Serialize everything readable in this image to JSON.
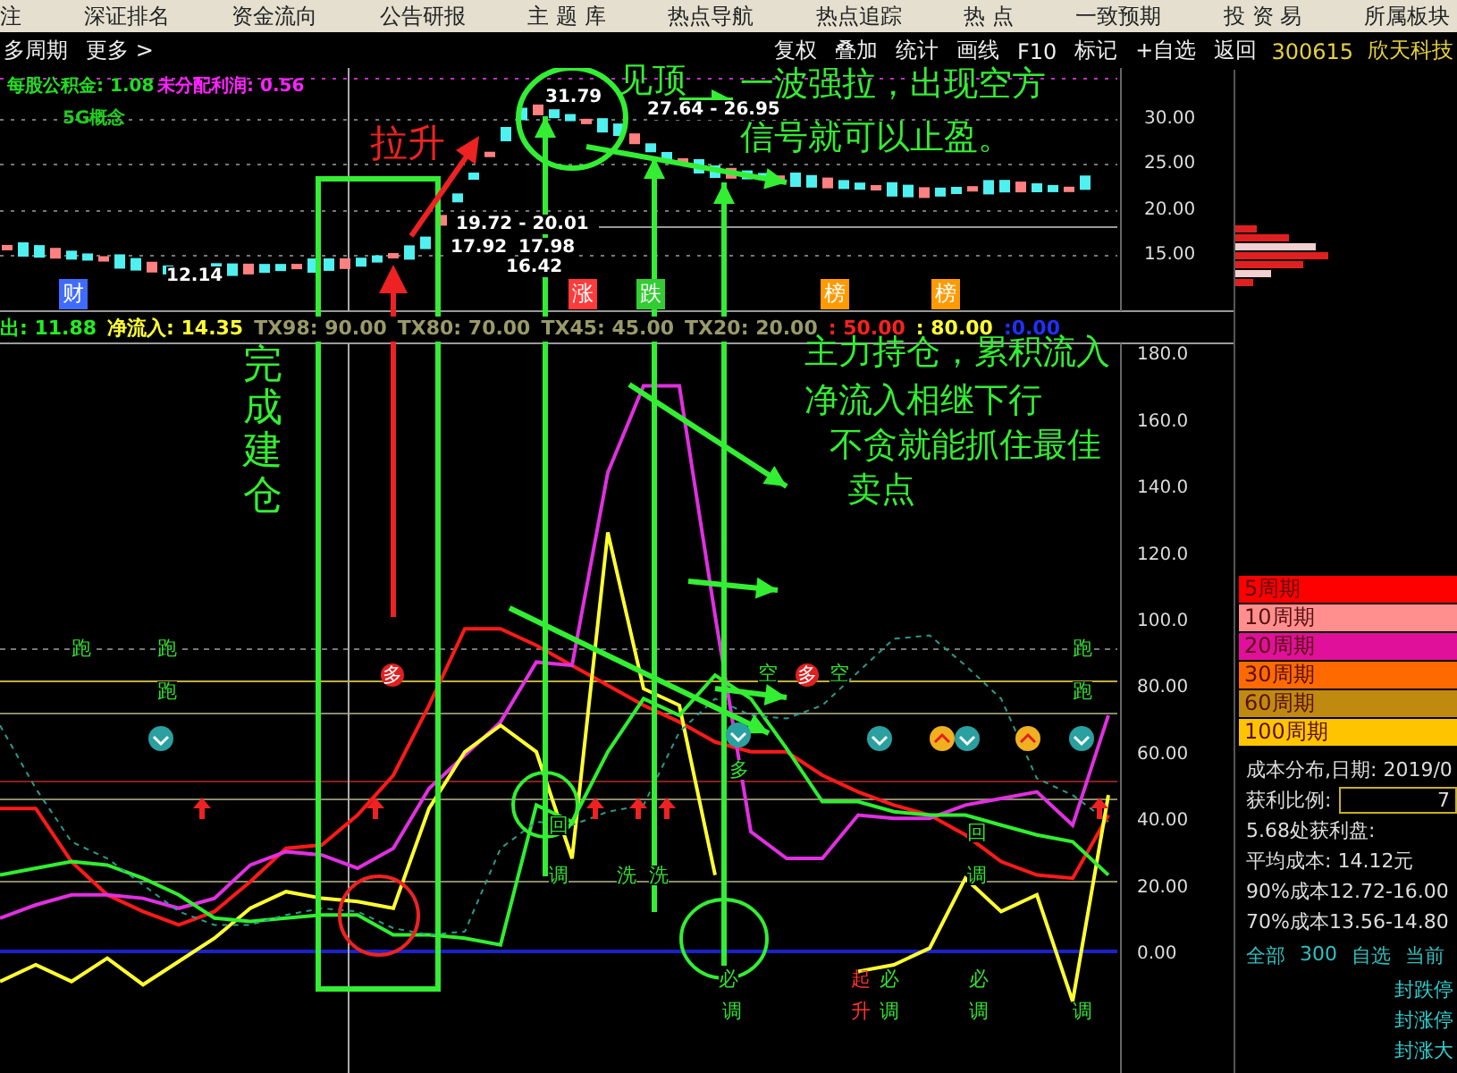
{
  "menu_bar": {
    "items": [
      "注",
      "深证排名",
      "资金流向",
      "公告研报",
      "主 题 库",
      "热点导航",
      "热点追踪",
      "热 点",
      "一致预期",
      "投 资 易",
      "所属板块"
    ]
  },
  "toolbar": {
    "left": [
      "多周期",
      "更多 >"
    ],
    "right": [
      "复权",
      "叠加",
      "统计",
      "画线",
      "F10",
      "标记",
      "+自选",
      "返回"
    ],
    "stock_code": "300615",
    "stock_name": "欣天科技"
  },
  "price_pane": {
    "info": [
      {
        "text": "每股公积金: 1.08",
        "color": "#22dd22"
      },
      {
        "text": "未分配利润: 0.56",
        "color": "#ff22ff"
      }
    ],
    "concept_tag": "5G概念",
    "price_labels": [
      "31.79",
      "27.64 - 26.95",
      "19.72 - 20.01",
      "17.92",
      "17.98",
      "16.42",
      "12.14"
    ],
    "event_tags": [
      {
        "text": "财",
        "color": "#3f6bff"
      },
      {
        "text": "涨",
        "color": "#ff3b3b"
      },
      {
        "text": "跌",
        "color": "#33cc33"
      },
      {
        "text": "榜",
        "color": "#ff9a00"
      },
      {
        "text": "榜",
        "color": "#ff9a00"
      }
    ],
    "axis_labels": [
      "30.00",
      "25.00",
      "20.00",
      "15.00"
    ]
  },
  "indicator_line": [
    {
      "text": "出: 11.88",
      "color": "#22ee22"
    },
    {
      "text": "净流入: 14.35",
      "color": "#ffff33"
    },
    {
      "text": "TX98: 90.00",
      "color": "#9a9a6a"
    },
    {
      "text": "TX80: 70.00",
      "color": "#9a9a6a"
    },
    {
      "text": "TX45: 45.00",
      "color": "#9a9a6a"
    },
    {
      "text": "TX20: 20.00",
      "color": "#9a9a6a"
    },
    {
      "text": ": 50.00",
      "color": "#ff2020"
    },
    {
      "text": ": 80.00",
      "color": "#ffff33"
    },
    {
      "text": ":0.00",
      "color": "#2030ff"
    }
  ],
  "indicator_pane": {
    "chart_data": {
      "type": "line",
      "ylim": [
        -36,
        182
      ],
      "yticks": [
        {
          "value": 180,
          "label": "180.0"
        },
        {
          "value": 160,
          "label": "160.0"
        },
        {
          "value": 140,
          "label": "140.0"
        },
        {
          "value": 120,
          "label": "120.0"
        },
        {
          "value": 100,
          "label": "100.0"
        },
        {
          "value": 80,
          "label": "80.00"
        },
        {
          "value": 60,
          "label": "60.00"
        },
        {
          "value": 40,
          "label": "40.00"
        },
        {
          "value": 20,
          "label": "20.00"
        },
        {
          "value": 0,
          "label": "0.00"
        }
      ],
      "series": [
        {
          "color": "#ff1a1a",
          "line_style": "solid",
          "values": [
            43,
            43,
            27,
            17,
            12,
            8,
            12,
            21,
            31,
            32,
            41,
            53,
            74,
            97,
            97,
            92,
            86,
            80,
            74,
            69,
            63,
            60,
            60,
            53,
            48,
            44,
            41,
            35,
            27,
            23,
            22,
            41
          ]
        },
        {
          "color": "#e030e0",
          "line_style": "solid",
          "values": [
            10,
            14,
            17,
            17,
            16,
            13,
            16,
            26,
            30,
            29,
            25,
            31,
            49,
            59,
            69,
            87,
            86,
            144,
            170,
            170,
            101,
            36,
            28,
            28,
            41,
            40,
            40,
            44,
            46,
            48,
            38,
            71
          ]
        },
        {
          "color": "#ffff30",
          "line_style": "solid",
          "values": [
            -9,
            -4,
            -9,
            -2,
            -10,
            -3,
            4,
            13,
            18,
            16,
            15,
            13,
            43,
            60,
            68,
            60,
            28,
            126,
            79,
            74,
            23,
            null,
            null,
            null,
            -6,
            -4,
            1,
            22,
            12,
            17,
            -15,
            47
          ]
        },
        {
          "color": "#30ee30",
          "line_style": "solid",
          "values": [
            23,
            25,
            27,
            26,
            22,
            17,
            10,
            9,
            10,
            11,
            11,
            5,
            5,
            4,
            2,
            44,
            39,
            60,
            76,
            71,
            83,
            76,
            61,
            45,
            45,
            42,
            41,
            41,
            38,
            35,
            33,
            23
          ]
        },
        {
          "color": "#2a9a8a",
          "line_style": "dashed",
          "values": [
            68,
            49,
            33,
            28,
            20,
            12,
            8,
            8,
            11,
            13,
            12,
            7,
            5,
            6,
            31,
            39,
            38,
            42,
            44,
            66,
            76,
            71,
            70,
            74,
            84,
            94,
            95,
            86,
            76,
            52,
            47,
            39
          ]
        }
      ]
    },
    "signal_marks": [
      {
        "text": "跑",
        "kind": "green"
      },
      {
        "text": "跑",
        "kind": "green"
      },
      {
        "text": "跑",
        "kind": "green"
      },
      {
        "text": "多",
        "kind": "badge"
      },
      {
        "text": "空",
        "kind": "green"
      },
      {
        "text": "多",
        "kind": "badge"
      },
      {
        "text": "空",
        "kind": "green"
      },
      {
        "text": "跑",
        "kind": "green"
      },
      {
        "text": "跑",
        "kind": "green"
      },
      {
        "text": "多",
        "kind": "green"
      },
      {
        "text": "回",
        "kind": "green"
      },
      {
        "text": "回",
        "kind": "green"
      },
      {
        "text": "调",
        "kind": "green"
      },
      {
        "text": "洗",
        "kind": "green"
      },
      {
        "text": "洗",
        "kind": "green"
      },
      {
        "text": "调",
        "kind": "green"
      },
      {
        "text": "必",
        "kind": "green"
      },
      {
        "text": "起",
        "kind": "red"
      },
      {
        "text": "必",
        "kind": "green"
      },
      {
        "text": "必",
        "kind": "green"
      },
      {
        "text": "调",
        "kind": "green"
      },
      {
        "text": "升",
        "kind": "red"
      },
      {
        "text": "调",
        "kind": "green"
      },
      {
        "text": "调",
        "kind": "green"
      },
      {
        "text": "调",
        "kind": "green"
      }
    ]
  },
  "annotations": [
    {
      "text": "完成建仓",
      "kind": "vertical"
    },
    {
      "text": "拉升",
      "kind": "red"
    },
    {
      "text": "见顶",
      "kind": "green"
    },
    {
      "text": "一波强拉，出现空方",
      "kind": "green"
    },
    {
      "text": "信号就可以止盈。",
      "kind": "green"
    },
    {
      "text": "主力持仓，累积流入",
      "kind": "green"
    },
    {
      "text": "净流入相继下行",
      "kind": "green"
    },
    {
      "text": "不贪就能抓住最佳",
      "kind": "green"
    },
    {
      "text": "卖点",
      "kind": "green"
    }
  ],
  "legend": [
    {
      "label": "5周期",
      "color": "#ff0000"
    },
    {
      "label": "10周期",
      "color": "#ff8f8f"
    },
    {
      "label": "20周期",
      "color": "#e0109a"
    },
    {
      "label": "30周期",
      "color": "#ff6a00"
    },
    {
      "label": "60周期",
      "color": "#c08a10"
    },
    {
      "label": "100周期",
      "color": "#ffc400"
    }
  ],
  "cost_panel": {
    "date_label": "成本分布,日期: 2019/0",
    "profit_label": "获利比例:",
    "profit_value": "7",
    "lines": [
      "5.68处获利盘:",
      "平均成本: 14.12元",
      "90%成本12.72-16.00",
      "70%成本13.56-14.80"
    ]
  },
  "stock_list": {
    "tabs": [
      "全部",
      "300",
      "自选",
      "当前"
    ],
    "rows": [
      "封跌停",
      "封涨停",
      "封涨大"
    ]
  }
}
